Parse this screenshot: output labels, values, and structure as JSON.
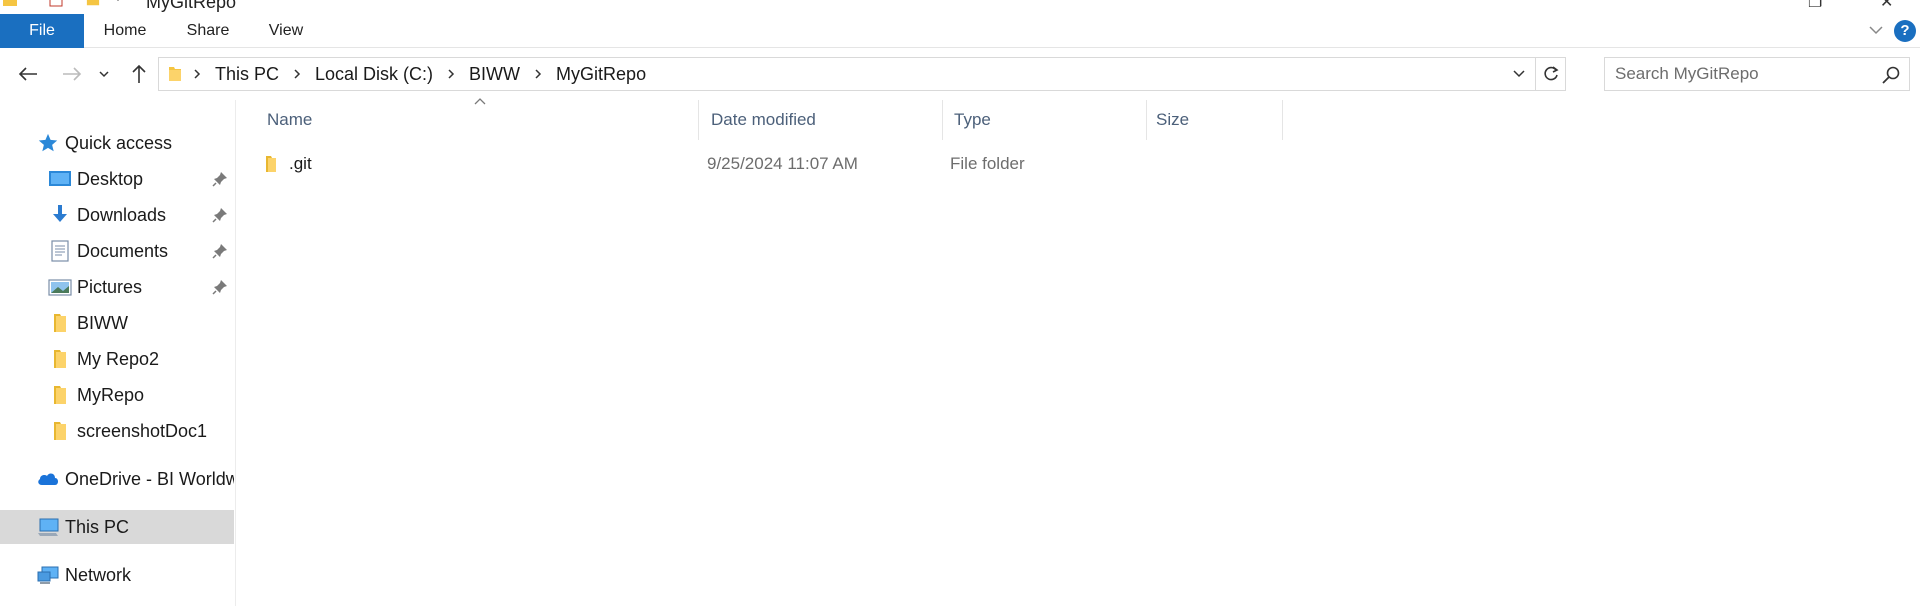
{
  "window": {
    "title": "MyGitRepo"
  },
  "ribbon": {
    "tabs": [
      {
        "label": "File"
      },
      {
        "label": "Home"
      },
      {
        "label": "Share"
      },
      {
        "label": "View"
      }
    ],
    "accent_color": "#1a6fc0"
  },
  "address": {
    "crumbs": [
      "This PC",
      "Local Disk (C:)",
      "BIWW",
      "MyGitRepo"
    ]
  },
  "search": {
    "placeholder": "Search MyGitRepo"
  },
  "nav": {
    "quick_access": "Quick access",
    "pinned": [
      {
        "label": "Desktop",
        "icon": "desktop-icon"
      },
      {
        "label": "Downloads",
        "icon": "download-icon"
      },
      {
        "label": "Documents",
        "icon": "documents-icon"
      },
      {
        "label": "Pictures",
        "icon": "pictures-icon"
      }
    ],
    "folders": [
      {
        "label": "BIWW"
      },
      {
        "label": "My Repo2"
      },
      {
        "label": "MyRepo"
      },
      {
        "label": "screenshotDoc1"
      }
    ],
    "onedrive": "OneDrive - BI Worldw",
    "this_pc": "This PC",
    "network": "Network"
  },
  "columns": {
    "name": "Name",
    "date_modified": "Date modified",
    "type": "Type",
    "size": "Size"
  },
  "files": [
    {
      "name": ".git",
      "date_modified": "9/25/2024 11:07 AM",
      "type": "File folder",
      "size": ""
    }
  ]
}
